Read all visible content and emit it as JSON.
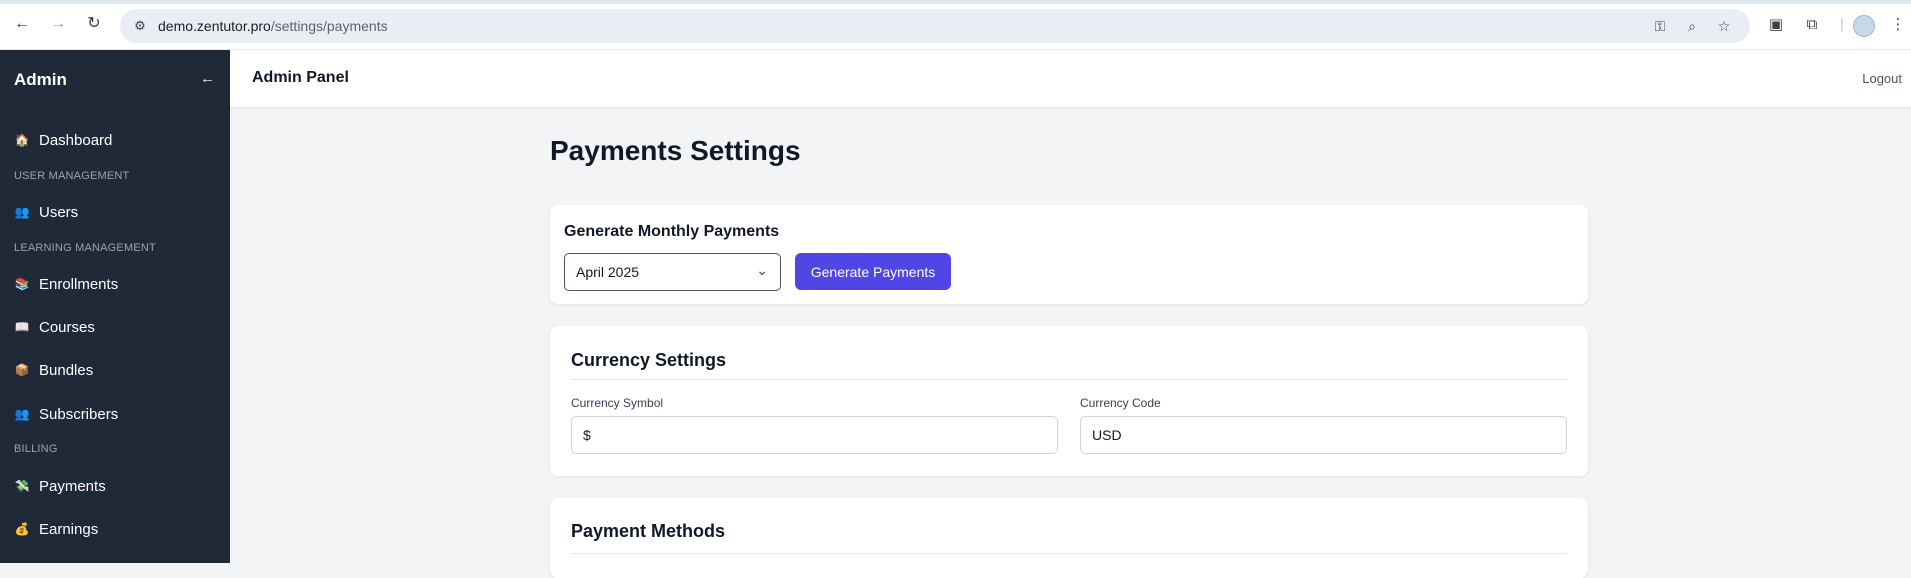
{
  "browser": {
    "url_domain": "demo.zentutor.pro",
    "url_path": "/settings/payments"
  },
  "sidebar": {
    "brand": "Admin",
    "collapse_icon": "←",
    "items": [
      {
        "label": "Dashboard",
        "icon": "🏠"
      },
      {
        "section": "USER MANAGEMENT"
      },
      {
        "label": "Users",
        "icon": "👥"
      },
      {
        "section": "LEARNING MANAGEMENT"
      },
      {
        "label": "Enrollments",
        "icon": "📚"
      },
      {
        "label": "Courses",
        "icon": "📖"
      },
      {
        "label": "Bundles",
        "icon": "📦"
      },
      {
        "label": "Subscribers",
        "icon": "👥"
      },
      {
        "section": "BILLING"
      },
      {
        "label": "Payments",
        "icon": "💸"
      },
      {
        "label": "Earnings",
        "icon": "💰"
      }
    ]
  },
  "topbar": {
    "title": "Admin Panel",
    "logout": "Logout"
  },
  "page": {
    "title": "Payments Settings"
  },
  "generate": {
    "title": "Generate Monthly Payments",
    "month_selected": "April 2025",
    "button": "Generate Payments"
  },
  "currency": {
    "title": "Currency Settings",
    "symbol_label": "Currency Symbol",
    "symbol_value": "$",
    "code_label": "Currency Code",
    "code_value": "USD"
  },
  "methods": {
    "title": "Payment Methods"
  },
  "colors": {
    "sidebar_bg": "#1f2937",
    "accent": "#4f46e5",
    "page_bg": "#f3f4f6"
  }
}
